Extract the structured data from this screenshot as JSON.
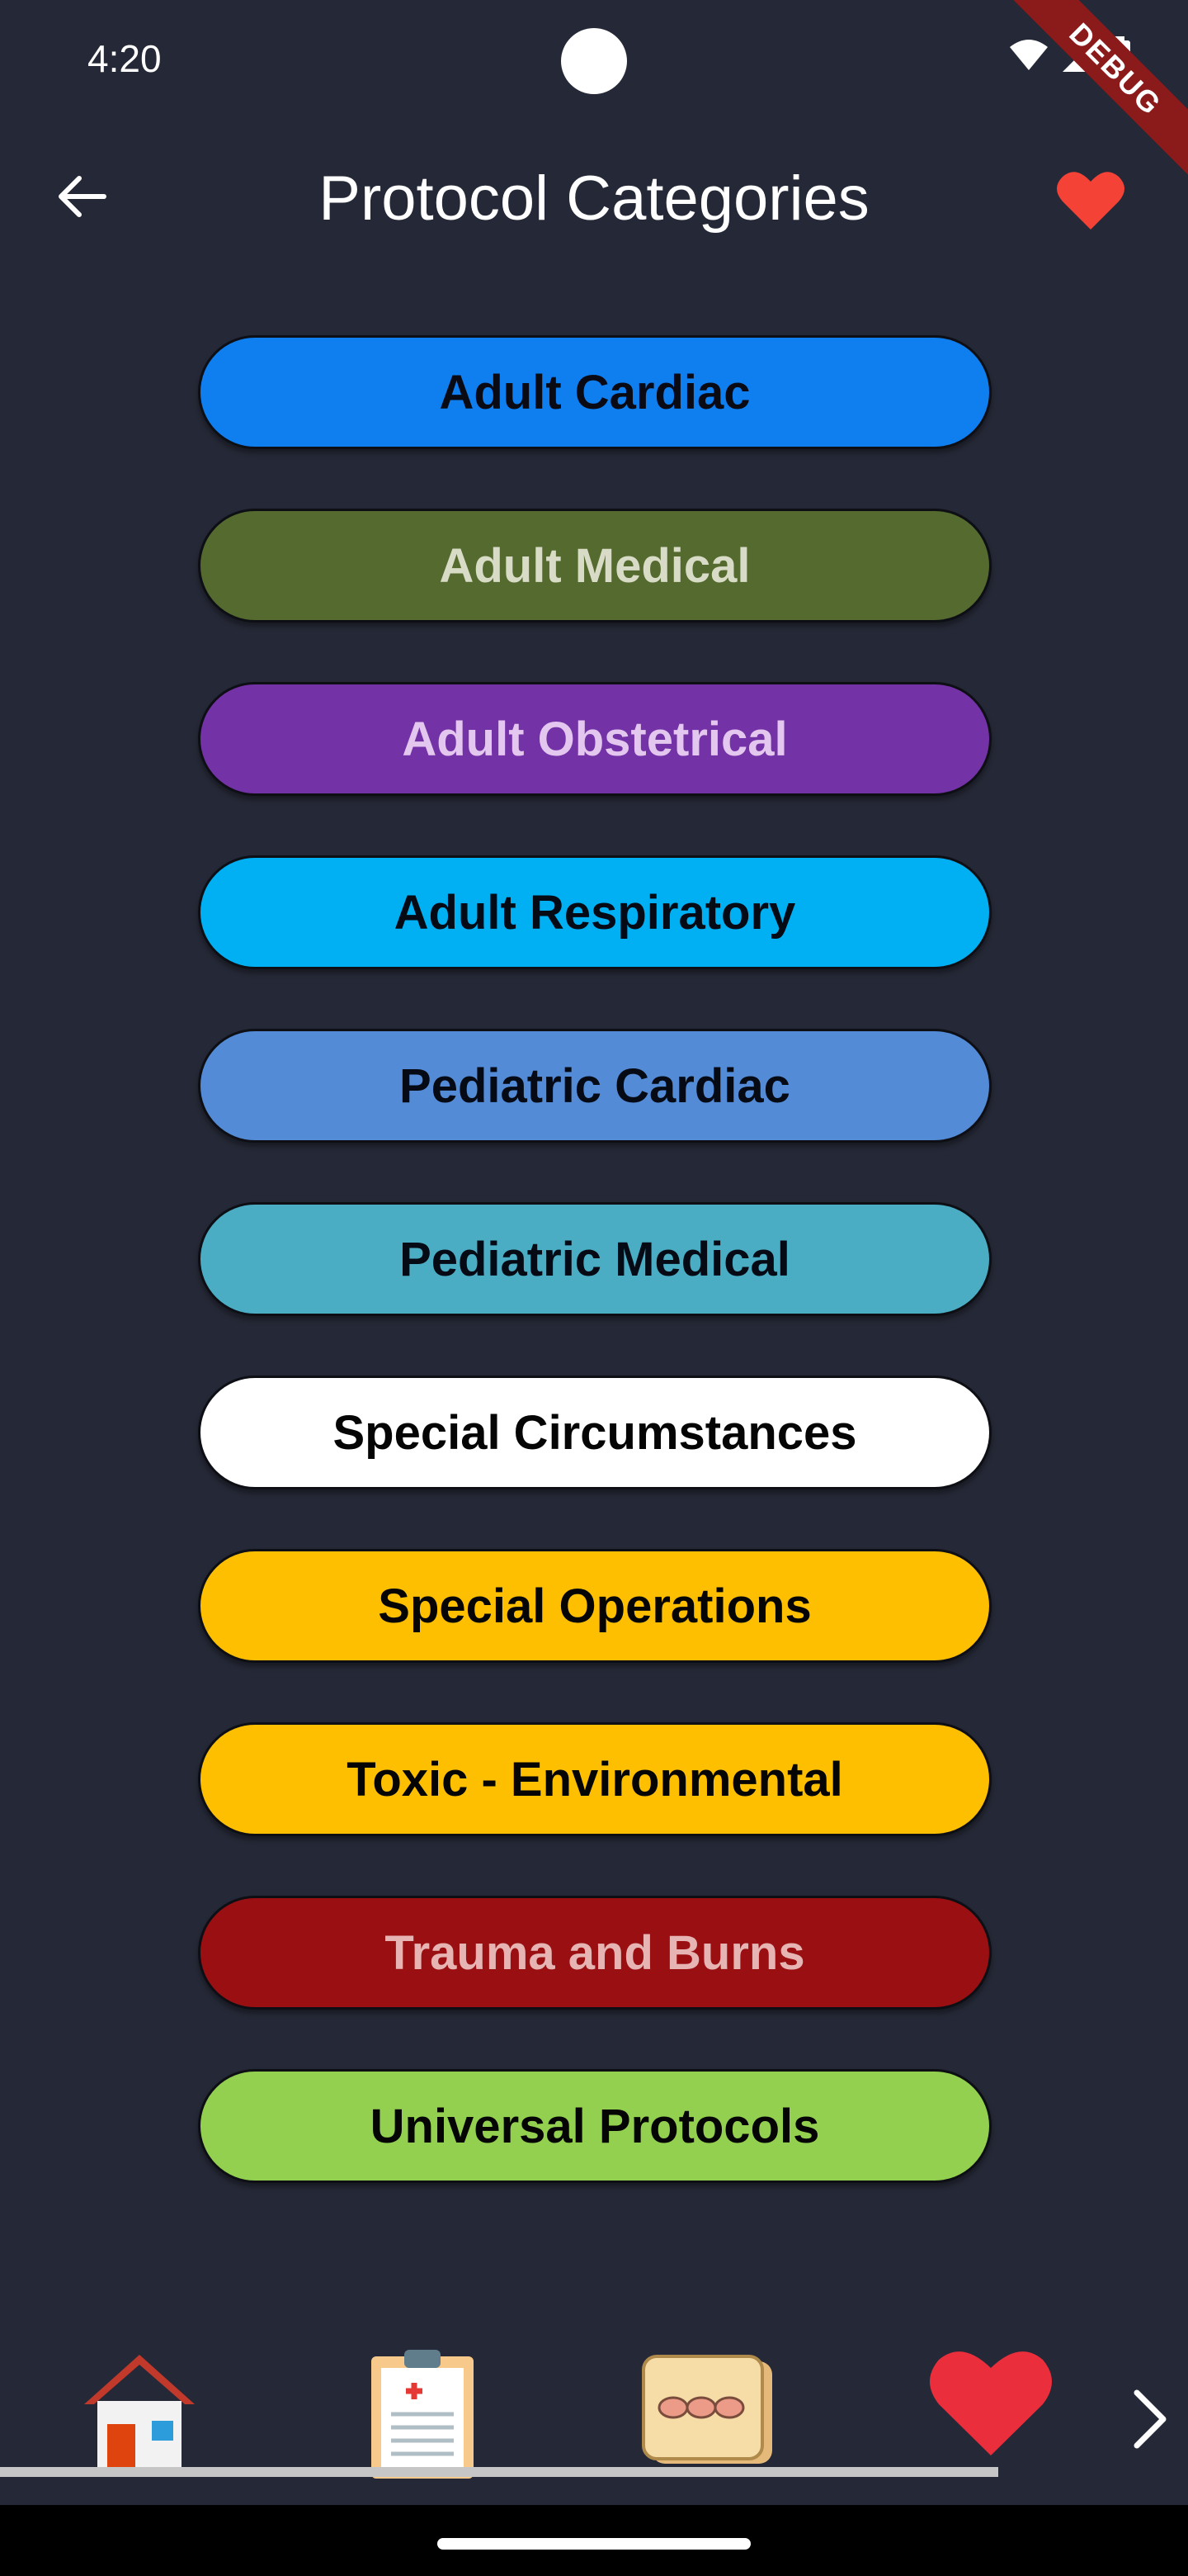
{
  "status_bar": {
    "time": "4:20",
    "debug_label": "DEBUG"
  },
  "app_bar": {
    "title": "Protocol Categories"
  },
  "categories": [
    {
      "label": "Adult Cardiac",
      "bg": "#0f7ff0",
      "fg": "#0a0a14"
    },
    {
      "label": "Adult Medical",
      "bg": "#546a2e",
      "fg": "#d8dcc6"
    },
    {
      "label": "Adult Obstetrical",
      "bg": "#7432a7",
      "fg": "#e3c7ee"
    },
    {
      "label": "Adult Respiratory",
      "bg": "#00b0f3",
      "fg": "#050a14"
    },
    {
      "label": "Pediatric Cardiac",
      "bg": "#538bd6",
      "fg": "#050a14"
    },
    {
      "label": "Pediatric Medical",
      "bg": "#4badc4",
      "fg": "#050a14"
    },
    {
      "label": "Special Circumstances",
      "bg": "#ffffff",
      "fg": "#050505"
    },
    {
      "label": "Special Operations",
      "bg": "#fdbf00",
      "fg": "#050505"
    },
    {
      "label": "Toxic - Environmental",
      "bg": "#fdbf00",
      "fg": "#050505"
    },
    {
      "label": "Trauma and Burns",
      "bg": "#9a0f12",
      "fg": "#e6b4b3"
    },
    {
      "label": "Universal Protocols",
      "bg": "#93d050",
      "fg": "#050505"
    }
  ],
  "bottom_nav": {
    "items": [
      {
        "icon": "home-icon"
      },
      {
        "icon": "clipboard-icon"
      },
      {
        "icon": "pills-icon"
      },
      {
        "icon": "heart-icon"
      }
    ],
    "next_icon": "chevron-right-icon"
  },
  "colors": {
    "background": "#252836",
    "accent_heart": "#f44336"
  }
}
